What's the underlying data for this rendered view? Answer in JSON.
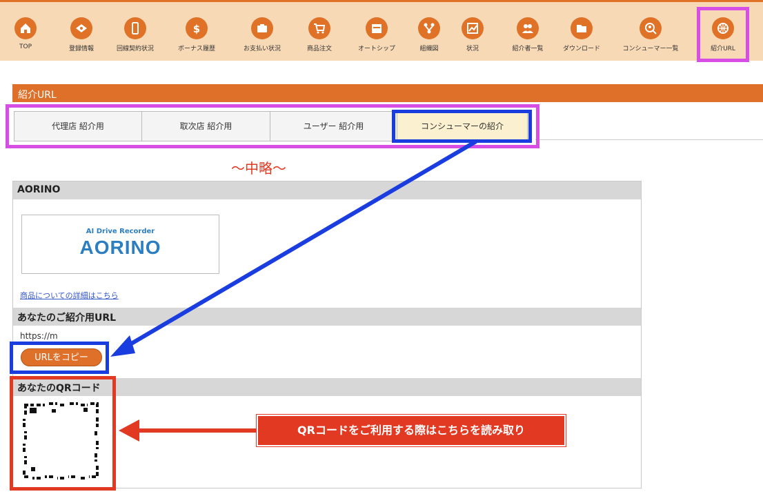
{
  "nav": {
    "items": [
      {
        "label": "TOP",
        "icon": "home-icon"
      },
      {
        "label": "登録情報",
        "icon": "tag-icon"
      },
      {
        "label": "回線契約状況",
        "icon": "phone-icon"
      },
      {
        "label": "ボーナス履歴",
        "icon": "dollar-icon"
      },
      {
        "label": "お支払い状況",
        "icon": "wallet-icon"
      },
      {
        "label": "商品注文",
        "icon": "cart-icon"
      },
      {
        "label": "オートシップ",
        "icon": "calendar-icon"
      },
      {
        "label": "組織図",
        "icon": "network-icon"
      },
      {
        "label": "状況",
        "icon": "chart-icon"
      },
      {
        "label": "紹介者一覧",
        "icon": "users-icon"
      },
      {
        "label": "ダウンロード",
        "icon": "folder-icon"
      },
      {
        "label": "コンシューマー一覧",
        "icon": "search-user-icon"
      },
      {
        "label": "紹介URL",
        "icon": "globe-icon"
      }
    ],
    "accent": "#e07228",
    "background": "#f8d9b6"
  },
  "section": {
    "title": "紹介URL"
  },
  "tabs": [
    {
      "label": "代理店 紹介用",
      "active": false
    },
    {
      "label": "取次店 紹介用",
      "active": false
    },
    {
      "label": "ユーザー 紹介用",
      "active": false
    },
    {
      "label": "コンシューマーの紹介",
      "active": true
    }
  ],
  "omission_note": "～中略～",
  "product": {
    "name": "AORINO",
    "logo_sub": "AI Drive Recorder",
    "logo_main": "AORINO",
    "detail_link": "商品についての詳細はこちら"
  },
  "referral": {
    "heading": "あなたのご紹介用URL",
    "url": "https://m",
    "copy_button": "URLをコピー"
  },
  "qr": {
    "heading": "あなたのQRコード"
  },
  "callout": "QRコードをご利用する際はこちらを読み取り",
  "colors": {
    "magenta": "#d64ee3",
    "blue": "#1a3ddf",
    "red": "#e23a22"
  }
}
